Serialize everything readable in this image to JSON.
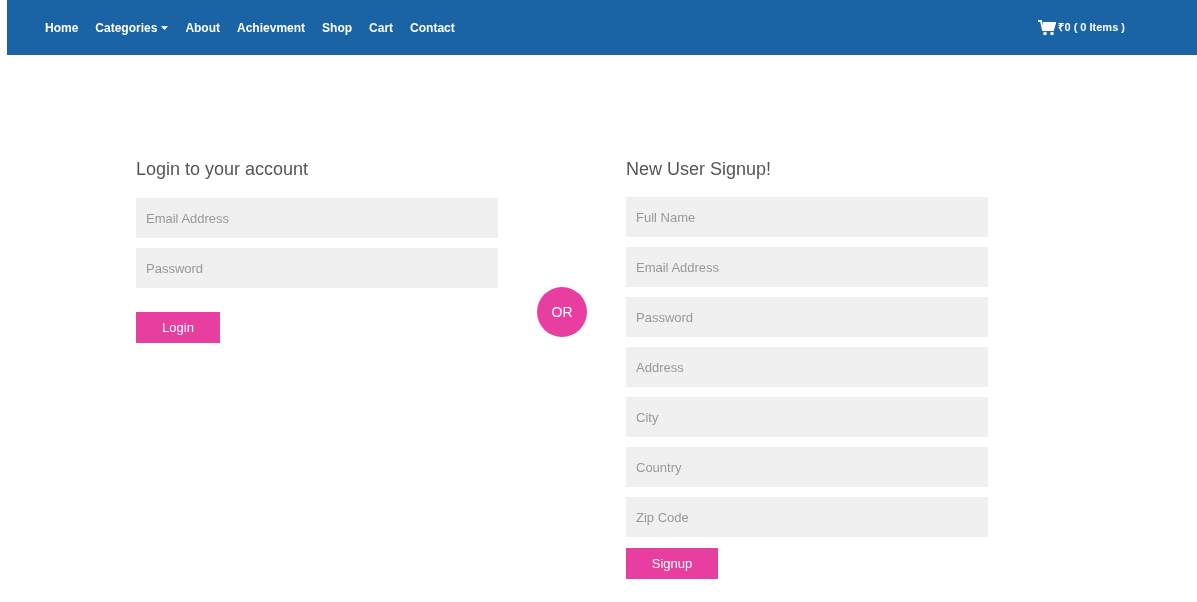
{
  "navbar": {
    "links": [
      {
        "label": "Home",
        "dropdown": false
      },
      {
        "label": "Categories",
        "dropdown": true
      },
      {
        "label": "About",
        "dropdown": false
      },
      {
        "label": "Achievment",
        "dropdown": false
      },
      {
        "label": "Shop",
        "dropdown": false
      },
      {
        "label": "Cart",
        "dropdown": false
      },
      {
        "label": "Contact",
        "dropdown": false
      }
    ],
    "cart": {
      "label": "₹0 ( 0 Items )"
    }
  },
  "login": {
    "title": "Login to your account",
    "fields": [
      {
        "placeholder": "Email Address"
      },
      {
        "placeholder": "Password"
      }
    ],
    "button": "Login"
  },
  "divider": "OR",
  "signup": {
    "title": "New User Signup!",
    "fields": [
      {
        "placeholder": "Full Name"
      },
      {
        "placeholder": "Email Address"
      },
      {
        "placeholder": "Password"
      },
      {
        "placeholder": "Address"
      },
      {
        "placeholder": "City"
      },
      {
        "placeholder": "Country"
      },
      {
        "placeholder": "Zip Code"
      }
    ],
    "button": "Signup"
  }
}
